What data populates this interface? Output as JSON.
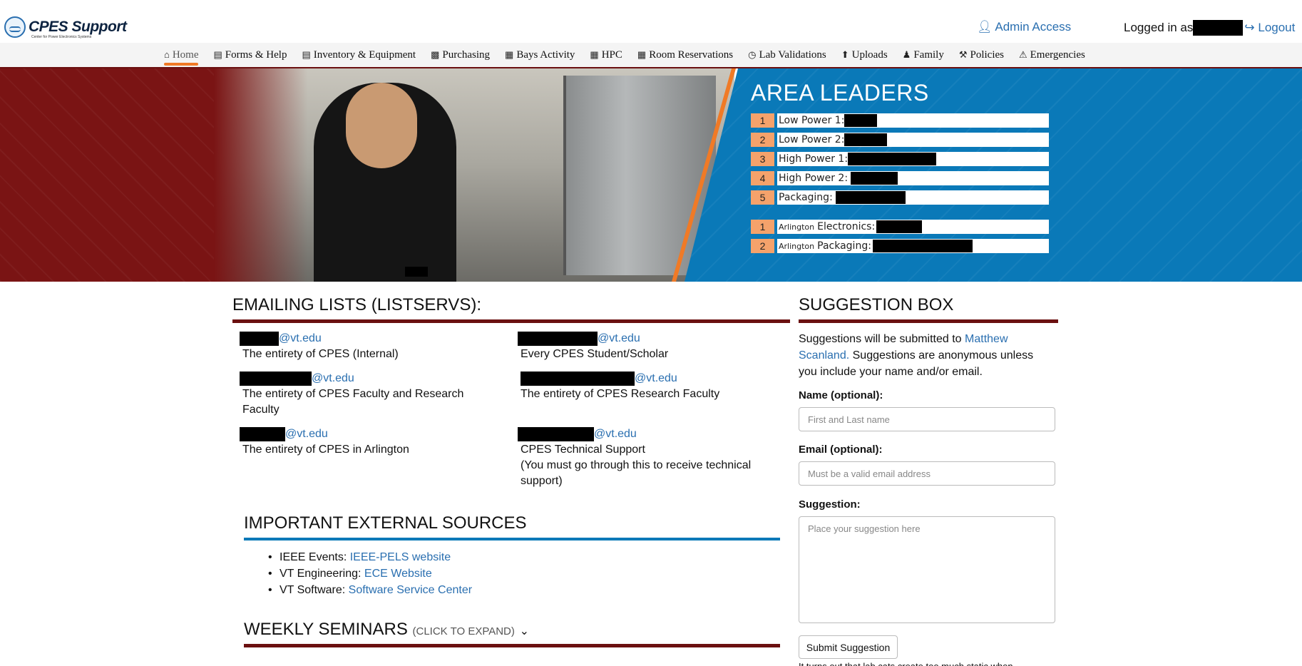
{
  "header": {
    "logo_text": "CPES Support",
    "logo_subtitle": "Center for Power Electronics Systems",
    "admin_label": "Admin Access",
    "logged_in_label": "Logged in as",
    "logout_label": "Logout"
  },
  "nav": {
    "items": [
      {
        "label": "Home",
        "icon": "home-icon"
      },
      {
        "label": "Forms & Help",
        "icon": "list-icon"
      },
      {
        "label": "Inventory & Equipment",
        "icon": "list-icon"
      },
      {
        "label": "Purchasing",
        "icon": "money-icon"
      },
      {
        "label": "Bays Activity",
        "icon": "calendar-icon"
      },
      {
        "label": "HPC",
        "icon": "calendar-icon"
      },
      {
        "label": "Room Reservations",
        "icon": "calendar-icon"
      },
      {
        "label": "Lab Validations",
        "icon": "clock-icon"
      },
      {
        "label": "Uploads",
        "icon": "upload-icon"
      },
      {
        "label": "Family",
        "icon": "user-icon"
      },
      {
        "label": "Policies",
        "icon": "gavel-icon"
      },
      {
        "label": "Emergencies",
        "icon": "warning-icon"
      }
    ],
    "active": "Home"
  },
  "area_leaders": {
    "title": "AREA LEADERS",
    "rows": [
      {
        "num": "1",
        "label": "Low Power 1:"
      },
      {
        "num": "2",
        "label": "Low Power 2:"
      },
      {
        "num": "3",
        "label": "High Power 1:"
      },
      {
        "num": "4",
        "label": "High Power 2:"
      },
      {
        "num": "5",
        "label": "Packaging:"
      }
    ],
    "arlington_rows": [
      {
        "num": "1",
        "prefix": "Arlington",
        "label": "Electronics:"
      },
      {
        "num": "2",
        "prefix": "Arlington",
        "label": "Packaging:"
      }
    ]
  },
  "emailing": {
    "title": "EMAILING LISTS (LISTSERVS):",
    "lists": [
      {
        "domain": "@vt.edu",
        "desc": "The entirety of CPES (Internal)"
      },
      {
        "domain": "@vt.edu",
        "desc": "Every CPES Student/Scholar"
      },
      {
        "domain": "@vt.edu",
        "desc": "The entirety of CPES Faculty and Research Faculty"
      },
      {
        "domain": "@vt.edu",
        "desc": "The entirety of CPES Research Faculty"
      },
      {
        "domain": "@vt.edu",
        "desc": "The entirety of CPES in Arlington"
      },
      {
        "domain": "@vt.edu",
        "desc": "CPES Technical Support",
        "note": "(You must go through this to receive technical support)"
      }
    ]
  },
  "external": {
    "title": "IMPORTANT EXTERNAL SOURCES",
    "items": [
      {
        "label": "IEEE Events:",
        "link": "IEEE-PELS website"
      },
      {
        "label": "VT Engineering:",
        "link": "ECE Website"
      },
      {
        "label": "VT Software:",
        "link": "Software Service Center"
      }
    ]
  },
  "seminars": {
    "title": "WEEKLY SEMINARS",
    "hint": "(CLICK TO EXPAND)"
  },
  "suggestion": {
    "title": "SUGGESTION BOX",
    "intro_pre": "Suggestions will be submitted to",
    "intro_name": "Matthew Scanland.",
    "intro_post": "Suggestions are anonymous unless you include your name and/or email.",
    "name_label": "Name (optional):",
    "name_placeholder": "First and Last name",
    "email_label": "Email (optional):",
    "email_placeholder": "Must be a valid email address",
    "suggestion_label": "Suggestion:",
    "suggestion_placeholder": "Place your suggestion here",
    "submit_label": "Submit Suggestion",
    "trailing_text": "It turns out that lab cats create too much static when"
  },
  "colors": {
    "maroon": "#6b1010",
    "banner_red": "#7a1414",
    "banner_blue": "#0a79b8",
    "accent_orange": "#f07a26",
    "link_blue": "#2a6fb0",
    "number_tag": "#f5a26b"
  }
}
